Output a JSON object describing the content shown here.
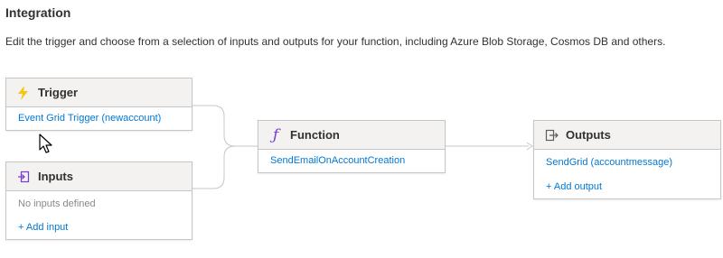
{
  "page": {
    "title": "Integration",
    "description": "Edit the trigger and choose from a selection of inputs and outputs for your function, including Azure Blob Storage, Cosmos DB and others."
  },
  "trigger": {
    "title": "Trigger",
    "icon": "lightning-icon",
    "item": "Event Grid Trigger (newaccount)"
  },
  "inputs": {
    "title": "Inputs",
    "icon": "input-arrow-icon",
    "empty_text": "No inputs defined",
    "add_label": "+ Add input"
  },
  "function": {
    "title": "Function",
    "icon": "function-f-icon",
    "item": "SendEmailOnAccountCreation"
  },
  "outputs": {
    "title": "Outputs",
    "icon": "output-arrow-icon",
    "item": "SendGrid (accountmessage)",
    "add_label": "+ Add output"
  },
  "colors": {
    "link": "#0078d4",
    "trigger_icon": "#f2c811",
    "function_icon": "#773adc",
    "border": "#c8c6c4",
    "header_bg": "#f3f2f1"
  }
}
